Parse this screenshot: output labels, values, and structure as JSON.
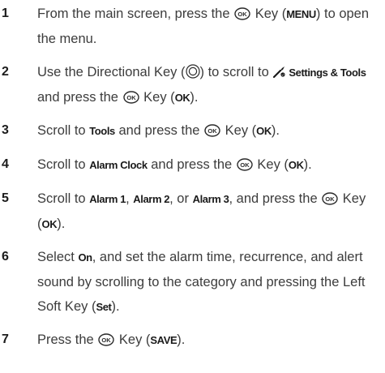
{
  "steps": [
    {
      "number": "1",
      "parts": [
        {
          "t": "text",
          "v": "From the main screen, press the "
        },
        {
          "t": "icon",
          "v": "ok-key-icon"
        },
        {
          "t": "text",
          "v": " Key ("
        },
        {
          "t": "ui",
          "v": "MENU"
        },
        {
          "t": "text",
          "v": ") to open the menu."
        }
      ]
    },
    {
      "number": "2",
      "parts": [
        {
          "t": "text",
          "v": "Use the Directional Key ("
        },
        {
          "t": "icon",
          "v": "directional-key-icon"
        },
        {
          "t": "text",
          "v": ") to scroll to "
        },
        {
          "t": "icon",
          "v": "settings-tools-icon"
        },
        {
          "t": "ui",
          "v": "Settings & Tools"
        },
        {
          "t": "text",
          "v": " and press the "
        },
        {
          "t": "icon",
          "v": "ok-key-icon"
        },
        {
          "t": "text",
          "v": " Key ("
        },
        {
          "t": "ui",
          "v": "OK"
        },
        {
          "t": "text",
          "v": ")."
        }
      ]
    },
    {
      "number": "3",
      "parts": [
        {
          "t": "text",
          "v": "Scroll to "
        },
        {
          "t": "ui",
          "v": "Tools"
        },
        {
          "t": "text",
          "v": " and press the "
        },
        {
          "t": "icon",
          "v": "ok-key-icon"
        },
        {
          "t": "text",
          "v": " Key ("
        },
        {
          "t": "ui",
          "v": "OK"
        },
        {
          "t": "text",
          "v": ")."
        }
      ]
    },
    {
      "number": "4",
      "parts": [
        {
          "t": "text",
          "v": "Scroll to "
        },
        {
          "t": "ui",
          "v": "Alarm Clock"
        },
        {
          "t": "text",
          "v": " and press the "
        },
        {
          "t": "icon",
          "v": "ok-key-icon"
        },
        {
          "t": "text",
          "v": " Key ("
        },
        {
          "t": "ui",
          "v": "OK"
        },
        {
          "t": "text",
          "v": ")."
        }
      ]
    },
    {
      "number": "5",
      "parts": [
        {
          "t": "text",
          "v": "Scroll to "
        },
        {
          "t": "ui",
          "v": "Alarm 1"
        },
        {
          "t": "text",
          "v": ", "
        },
        {
          "t": "ui",
          "v": "Alarm 2"
        },
        {
          "t": "text",
          "v": ", or "
        },
        {
          "t": "ui",
          "v": "Alarm 3"
        },
        {
          "t": "text",
          "v": ", and press the "
        },
        {
          "t": "icon",
          "v": "ok-key-icon"
        },
        {
          "t": "text",
          "v": " Key ("
        },
        {
          "t": "ui",
          "v": "OK"
        },
        {
          "t": "text",
          "v": ")."
        }
      ]
    },
    {
      "number": "6",
      "parts": [
        {
          "t": "text",
          "v": "Select "
        },
        {
          "t": "ui",
          "v": "On"
        },
        {
          "t": "text",
          "v": ", and set the alarm time, recurrence, and alert sound by scrolling to the category and pressing the Left Soft Key ("
        },
        {
          "t": "ui",
          "v": "Set"
        },
        {
          "t": "text",
          "v": ")."
        }
      ]
    },
    {
      "number": "7",
      "parts": [
        {
          "t": "text",
          "v": "Press the "
        },
        {
          "t": "icon",
          "v": "ok-key-icon"
        },
        {
          "t": "text",
          "v": " Key ("
        },
        {
          "t": "ui",
          "v": "SAVE"
        },
        {
          "t": "text",
          "v": ")."
        }
      ]
    }
  ]
}
